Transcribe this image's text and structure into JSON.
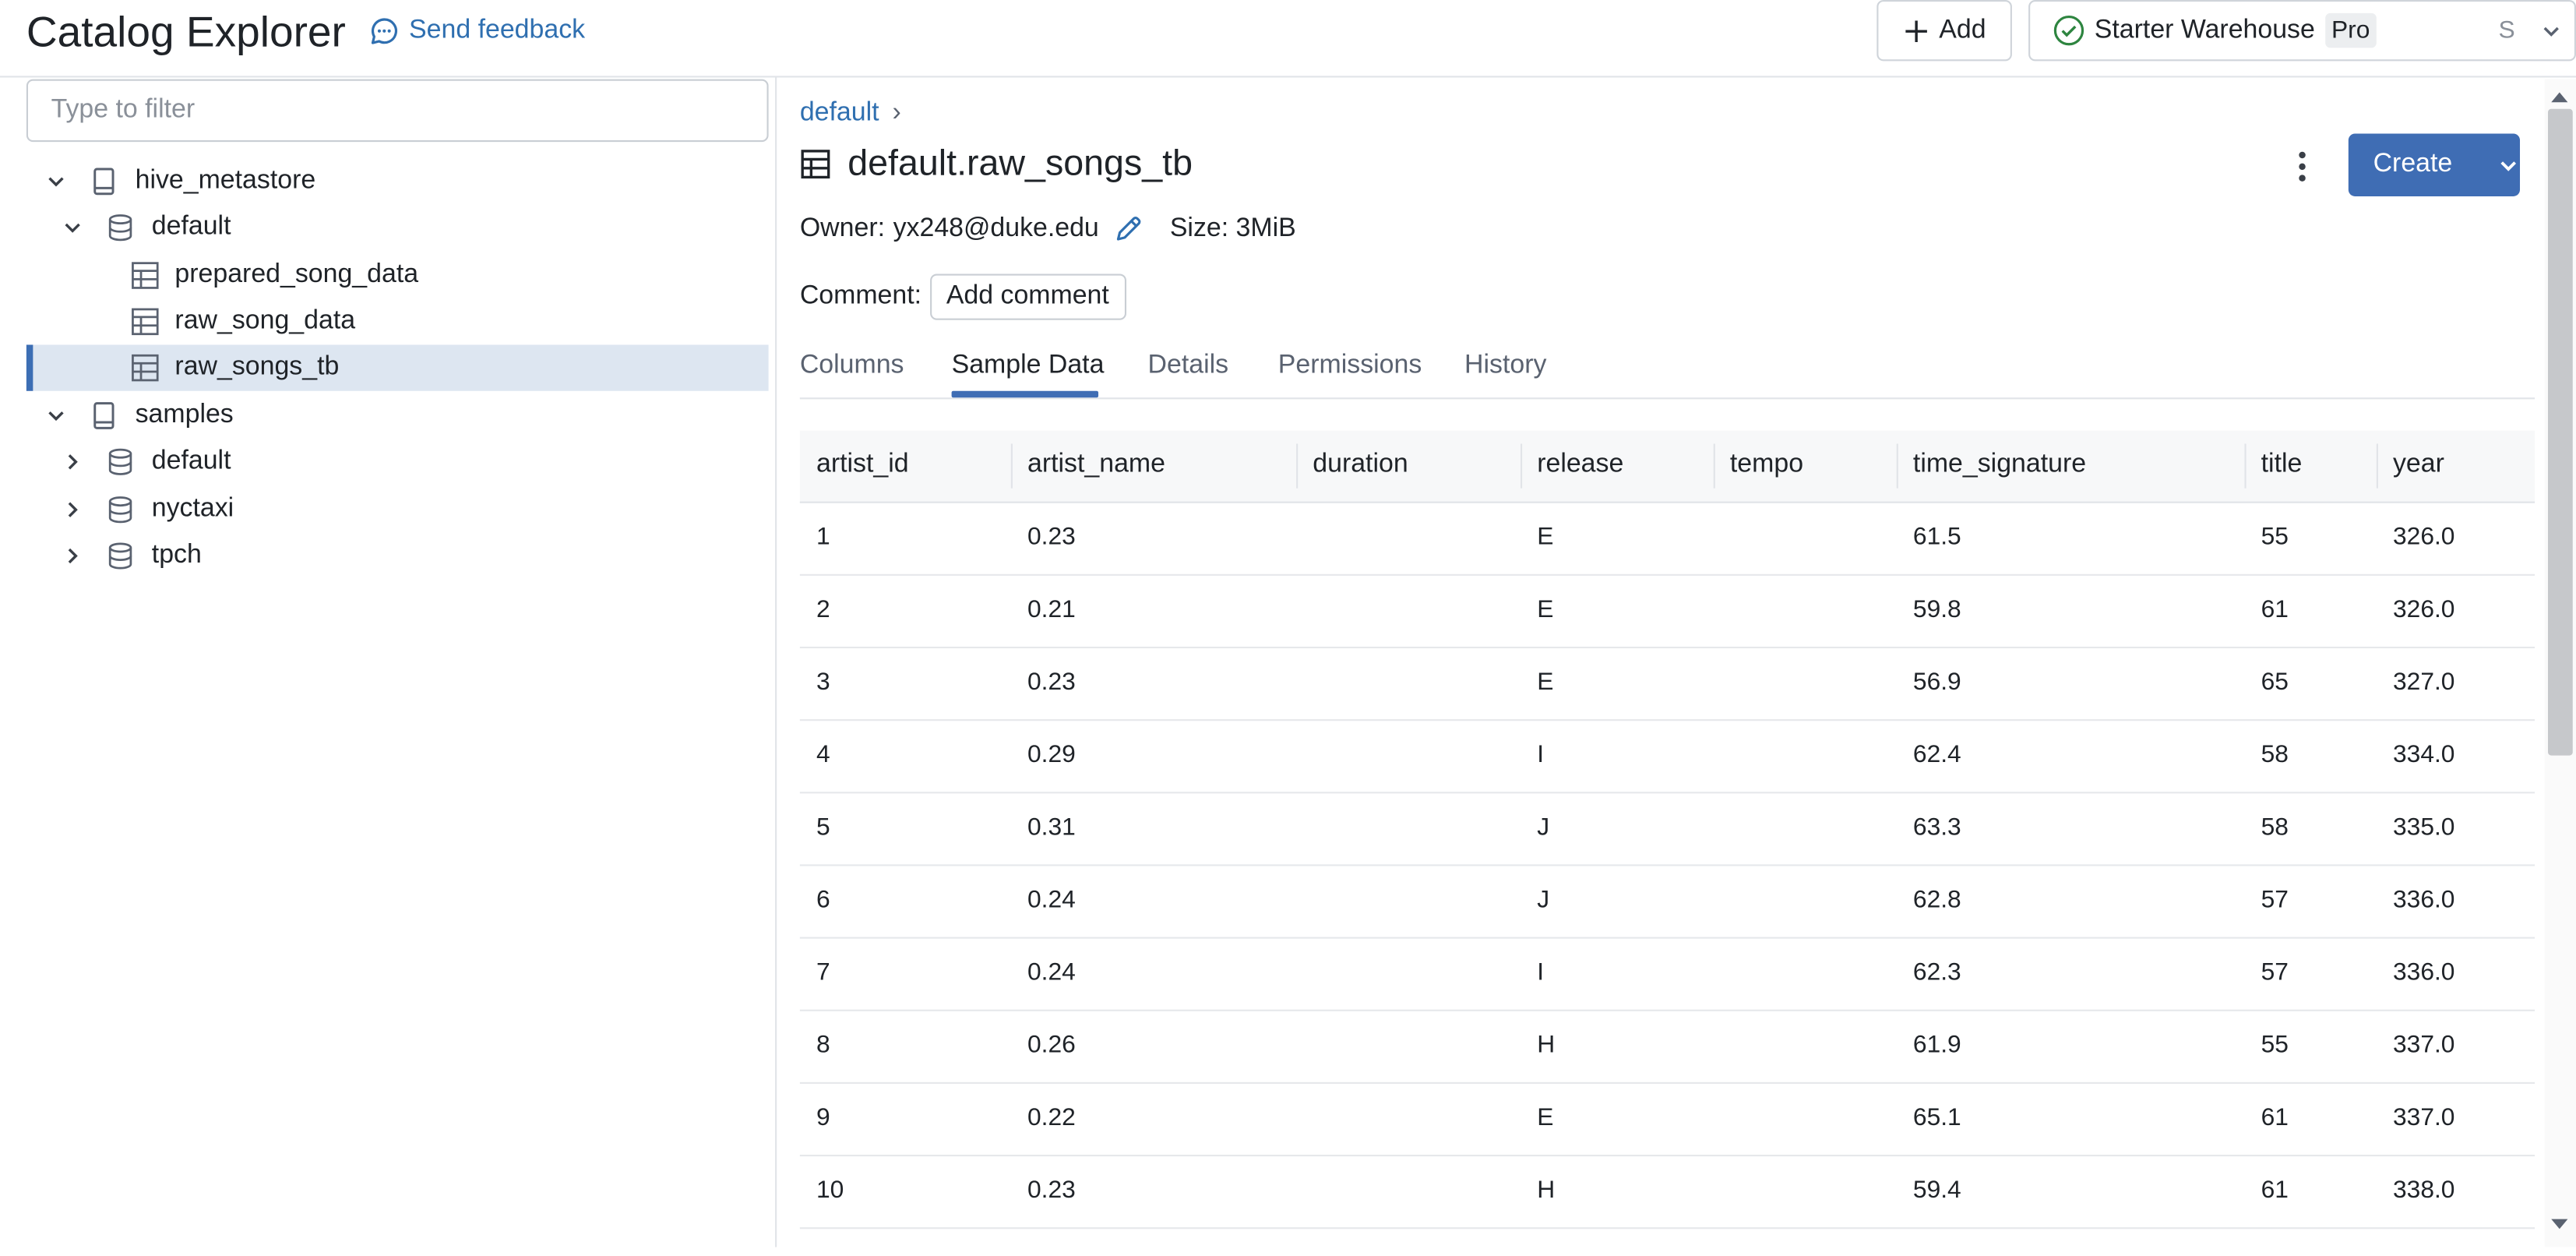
{
  "header": {
    "title": "Catalog Explorer",
    "feedback_label": "Send feedback",
    "add_label": "Add",
    "warehouse_name": "Starter Warehouse",
    "warehouse_tier": "Pro",
    "warehouse_size": "S",
    "warehouse_status_color": "#2e8540"
  },
  "sidebar": {
    "filter_placeholder": "Type to filter",
    "tree": [
      {
        "label": "hive_metastore",
        "kind": "catalog",
        "expanded": true,
        "level": 0
      },
      {
        "label": "default",
        "kind": "schema",
        "expanded": true,
        "level": 1
      },
      {
        "label": "prepared_song_data",
        "kind": "table",
        "level": 2
      },
      {
        "label": "raw_song_data",
        "kind": "table",
        "level": 2
      },
      {
        "label": "raw_songs_tb",
        "kind": "table",
        "level": 2,
        "selected": true
      },
      {
        "label": "samples",
        "kind": "catalog",
        "expanded": true,
        "level": 0
      },
      {
        "label": "default",
        "kind": "schema",
        "expanded": false,
        "level": 1
      },
      {
        "label": "nyctaxi",
        "kind": "schema",
        "expanded": false,
        "level": 1
      },
      {
        "label": "tpch",
        "kind": "schema",
        "expanded": false,
        "level": 1
      }
    ]
  },
  "main": {
    "breadcrumb": "default",
    "breadcrumb_sep": "›",
    "table_name": "default.raw_songs_tb",
    "create_label": "Create",
    "owner_label": "Owner:",
    "owner_value": "yx248@duke.edu",
    "size_text": "Size: 3MiB",
    "comment_label": "Comment:",
    "add_comment_label": "Add comment",
    "tabs": [
      "Columns",
      "Sample Data",
      "Details",
      "Permissions",
      "History"
    ],
    "active_tab": "Sample Data",
    "accent_color": "#3f6db4"
  },
  "sample_data": {
    "columns": [
      "artist_id",
      "artist_name",
      "duration",
      "release",
      "tempo",
      "time_signature",
      "title",
      "year"
    ],
    "rows": [
      [
        "1",
        "0.23",
        "",
        "E",
        "",
        "61.5",
        "55",
        "326.0"
      ],
      [
        "2",
        "0.21",
        "",
        "E",
        "",
        "59.8",
        "61",
        "326.0"
      ],
      [
        "3",
        "0.23",
        "",
        "E",
        "",
        "56.9",
        "65",
        "327.0"
      ],
      [
        "4",
        "0.29",
        "",
        "I",
        "",
        "62.4",
        "58",
        "334.0"
      ],
      [
        "5",
        "0.31",
        "",
        "J",
        "",
        "63.3",
        "58",
        "335.0"
      ],
      [
        "6",
        "0.24",
        "",
        "J",
        "",
        "62.8",
        "57",
        "336.0"
      ],
      [
        "7",
        "0.24",
        "",
        "I",
        "",
        "62.3",
        "57",
        "336.0"
      ],
      [
        "8",
        "0.26",
        "",
        "H",
        "",
        "61.9",
        "55",
        "337.0"
      ],
      [
        "9",
        "0.22",
        "",
        "E",
        "",
        "65.1",
        "61",
        "337.0"
      ],
      [
        "10",
        "0.23",
        "",
        "H",
        "",
        "59.4",
        "61",
        "338.0"
      ]
    ]
  }
}
